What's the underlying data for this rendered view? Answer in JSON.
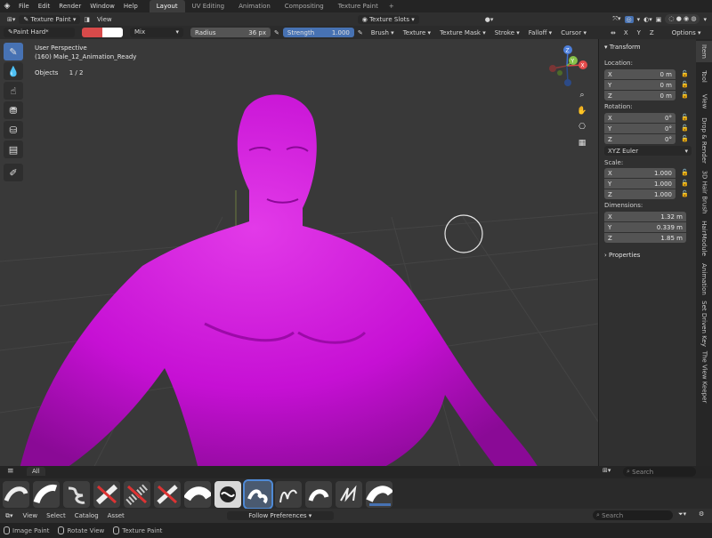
{
  "menu": {
    "items": [
      "File",
      "Edit",
      "Render",
      "Window",
      "Help"
    ],
    "workspaces": [
      "Layout",
      "UV Editing",
      "Animation",
      "Compositing",
      "Texture Paint"
    ],
    "active_workspace": "Layout",
    "add": "+"
  },
  "header": {
    "mode": "Texture Paint",
    "view": "View",
    "texture_slots": "Texture Slots"
  },
  "tool_settings": {
    "brush": "Paint Hard*",
    "color": "#d84a4a",
    "color2": "#ffffff",
    "blend": "Mix",
    "radius_label": "Radius",
    "radius_value": "36 px",
    "strength_label": "Strength",
    "strength_value": "1.000",
    "menus": [
      "Brush",
      "Texture",
      "Texture Mask",
      "Stroke",
      "Falloff",
      "Cursor"
    ],
    "axes": [
      "X",
      "Y",
      "Z"
    ],
    "options": "Options"
  },
  "viewport": {
    "perspective": "User Perspective",
    "object": "(160) Male_12_Animation_Ready",
    "objects_label": "Objects",
    "objects_count": "1 / 2",
    "mesh_color": "#cc10d9",
    "background_color": "#393939",
    "gizmo": {
      "x": "X",
      "y": "Y",
      "z": "Z"
    }
  },
  "transform": {
    "title": "Transform",
    "location_label": "Location:",
    "location": [
      {
        "axis": "X",
        "value": "0 m"
      },
      {
        "axis": "Y",
        "value": "0 m"
      },
      {
        "axis": "Z",
        "value": "0 m"
      }
    ],
    "rotation_label": "Rotation:",
    "rotation": [
      {
        "axis": "X",
        "value": "0°"
      },
      {
        "axis": "Y",
        "value": "0°"
      },
      {
        "axis": "Z",
        "value": "0°"
      }
    ],
    "rotation_mode": "XYZ Euler",
    "scale_label": "Scale:",
    "scale": [
      {
        "axis": "X",
        "value": "1.000"
      },
      {
        "axis": "Y",
        "value": "1.000"
      },
      {
        "axis": "Z",
        "value": "1.000"
      }
    ],
    "dimensions_label": "Dimensions:",
    "dimensions": [
      {
        "axis": "X",
        "value": "1.32 m"
      },
      {
        "axis": "Y",
        "value": "0.339 m"
      },
      {
        "axis": "Z",
        "value": "1.85 m"
      }
    ],
    "properties": "Properties"
  },
  "side_tabs": [
    "Item",
    "Tool",
    "View",
    "Drop & Render",
    "3D Hair Brush",
    "HairModule",
    "Animation",
    "Set Driven Key",
    "The View Keeper"
  ],
  "asset_shelf": {
    "tab": "All",
    "search_placeholder": "Search"
  },
  "bottom_bar": {
    "items": [
      "View",
      "Select",
      "Catalog",
      "Asset"
    ],
    "follow": "Follow Preferences",
    "search_placeholder": "Search"
  },
  "status": {
    "items": [
      "Image Paint",
      "Rotate View",
      "Texture Paint"
    ]
  }
}
